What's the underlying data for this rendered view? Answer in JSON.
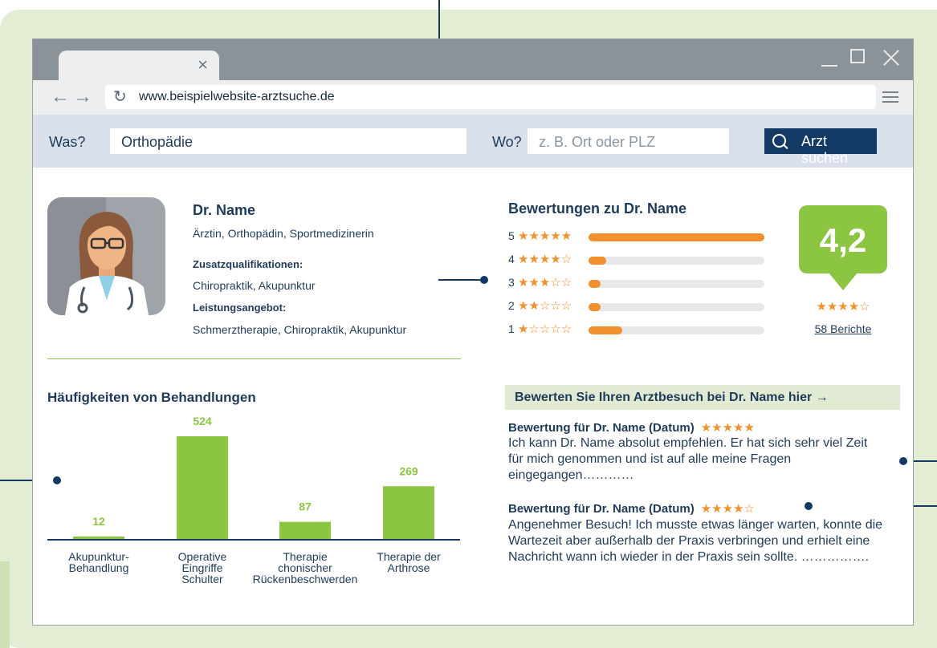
{
  "browser": {
    "tab_close_glyph": "×",
    "nav_arrows": "←→",
    "reload_glyph": "↻",
    "url": "www.beispielwebsite-arztsuche.de"
  },
  "search": {
    "what_label": "Was?",
    "what_value": "Orthopädie",
    "where_label": "Wo?",
    "where_placeholder": "z. B. Ort oder PLZ",
    "button_label": "Arzt suchen"
  },
  "doctor": {
    "name": "Dr. Name",
    "title": "Ärztin, Orthopädin, Sportmedizinerin",
    "qual_heading": "Zusatzqualifikationen:",
    "qual_text": "Chiropraktik, Akupunktur",
    "services_heading": "Leistungsangebot:",
    "services_text": "Schmerztherapie, Chiropraktik, Akupunktur"
  },
  "ratings": {
    "title": "Bewertungen zu Dr. Name",
    "rows": [
      {
        "num": "5",
        "stars": "★★★★★",
        "share": 1.0
      },
      {
        "num": "4",
        "stars": "★★★★☆",
        "share": 0.1
      },
      {
        "num": "3",
        "stars": "★★★☆☆",
        "share": 0.07
      },
      {
        "num": "2",
        "stars": "★★☆☆☆",
        "share": 0.07
      },
      {
        "num": "1",
        "stars": "★☆☆☆☆",
        "share": 0.19
      }
    ],
    "score": "4,2",
    "score_stars": "★★★★☆",
    "count_link": "58 Berichte",
    "star_color": "#f1902c"
  },
  "chart_data": {
    "type": "bar",
    "title": "Häufigkeiten von Behandlungen",
    "categories": [
      "Akupunktur-\nBehandlung",
      "Operative\nEingriffe\nSchulter",
      "Therapie\nchonischer\nRückenbeschwerden",
      "Therapie der\nArthrose"
    ],
    "values": [
      12,
      524,
      87,
      269
    ],
    "ylim": [
      0,
      524
    ],
    "bar_color": "#8cc542",
    "grid": false
  },
  "reviews": {
    "cta": "Bewerten Sie Ihren Arztbesuch bei Dr. Name hier →",
    "items": [
      {
        "heading": "Bewertung für Dr. Name (Datum)",
        "stars": "★★★★★",
        "text": "Ich kann Dr. Name absolut empfehlen. Er hat sich sehr viel Zeit für mich genommen und ist auf alle meine Fragen eingegangen…………"
      },
      {
        "heading": "Bewertung für Dr. Name (Datum)",
        "stars": "★★★★☆",
        "text": "Angenehmer Besuch! Ich musste etwas länger warten, konnte die Wartezeit aber außerhalb der Praxis verbringen und erhielt eine Nachricht wann ich wieder in der Praxis sein sollte. ……………."
      }
    ]
  },
  "colors": {
    "navy": "#123a64",
    "green": "#8cc542",
    "orange": "#f1902c",
    "panel_bg": "#e3edd3"
  }
}
